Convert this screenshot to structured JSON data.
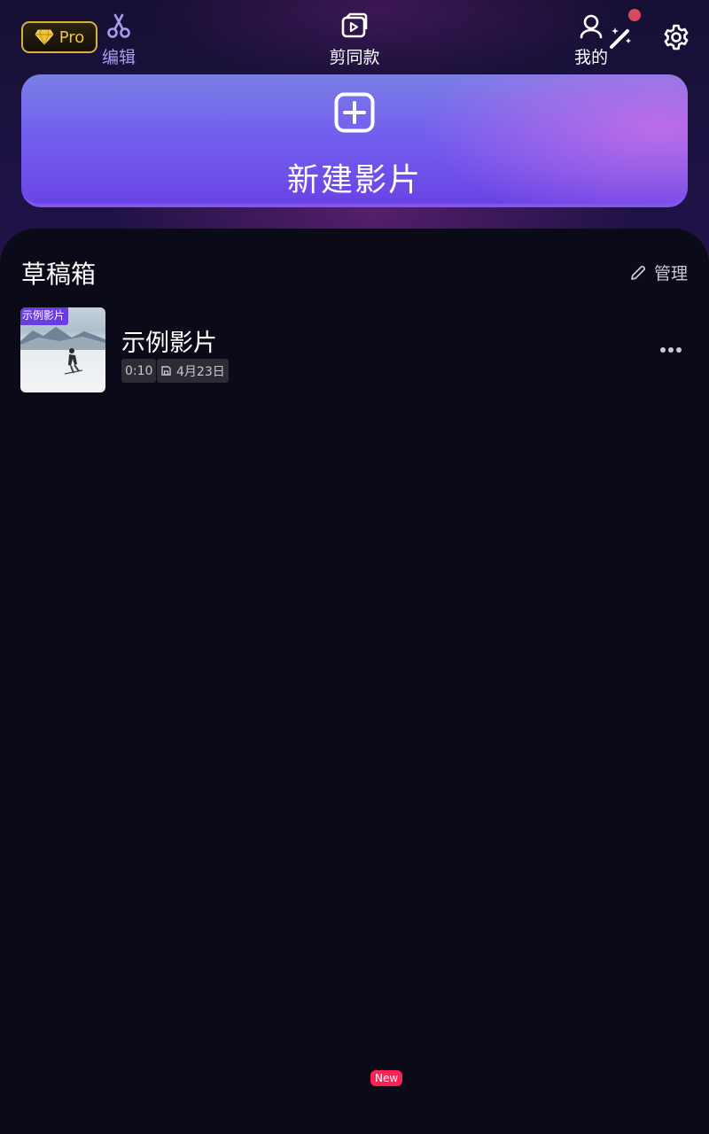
{
  "header": {
    "pro_label": "Pro",
    "icons": [
      "diamond-icon",
      "magic-wand-icon",
      "settings-icon"
    ],
    "notification_dot_color": "#d94a5d"
  },
  "new_project": {
    "label": "新建影片",
    "icon": "plus-square-icon"
  },
  "drafts": {
    "title": "草稿箱",
    "manage_label": "管理",
    "items": [
      {
        "tag": "示例影片",
        "title": "示例影片",
        "duration": "0:10",
        "date": "4月23日"
      }
    ]
  },
  "tabbar": {
    "tabs": [
      {
        "label": "编辑",
        "icon": "scissors-icon",
        "active": true
      },
      {
        "label": "剪同款",
        "icon": "template-video-icon",
        "badge": "New"
      },
      {
        "label": "我的",
        "icon": "user-icon"
      }
    ]
  },
  "colors": {
    "accent": "#7a5cf0",
    "pro_gold": "#f0c43b",
    "badge_red": "#ff2054",
    "background": "#0b0a18"
  }
}
